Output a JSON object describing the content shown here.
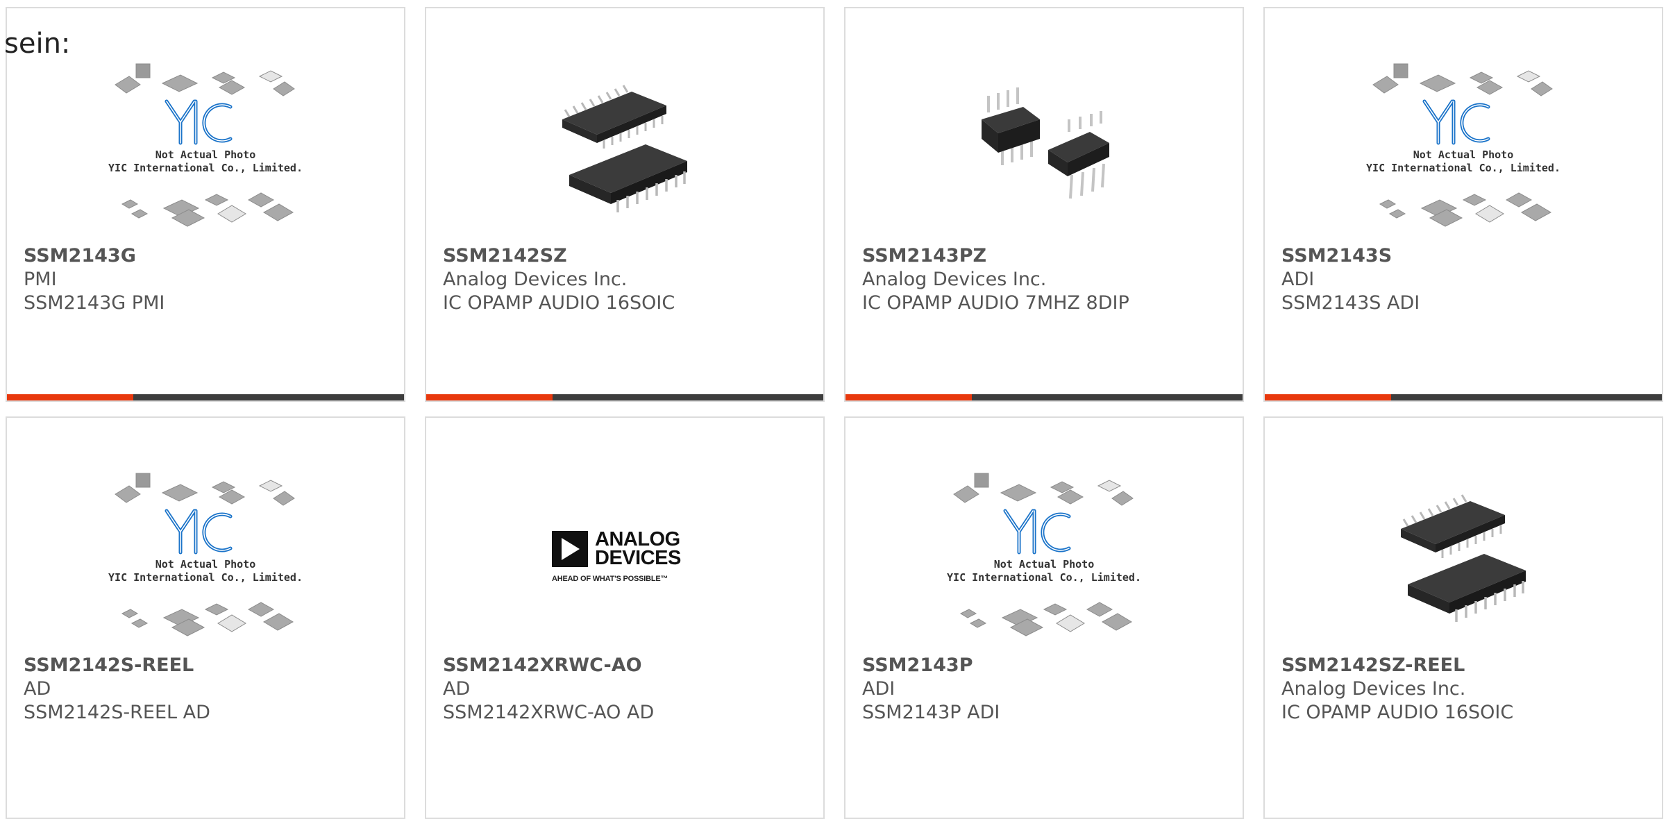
{
  "intro": "sein:",
  "placeholder_photo": {
    "line1": "Not Actual Photo",
    "line2": "YIC International Co., Limited.",
    "logo": "YIC"
  },
  "brand_logo": {
    "line1": "ANALOG",
    "line2": "DEVICES",
    "tagline": "AHEAD OF WHAT'S POSSIBLE™"
  },
  "colors": {
    "accent": "#e8380d",
    "bar": "#3d3d3d",
    "yic_blue": "#1a73c9"
  },
  "products": [
    {
      "part": "SSM2143G",
      "manufacturer": "PMI",
      "description": "SSM2143G PMI",
      "image": "not-actual-photo"
    },
    {
      "part": "SSM2142SZ",
      "manufacturer": "Analog Devices Inc.",
      "description": "IC OPAMP AUDIO 16SOIC",
      "image": "soic16-chip"
    },
    {
      "part": "SSM2143PZ",
      "manufacturer": "Analog Devices Inc.",
      "description": "IC OPAMP AUDIO 7MHZ 8DIP",
      "image": "dip8-chip"
    },
    {
      "part": "SSM2143S",
      "manufacturer": "ADI",
      "description": "SSM2143S ADI",
      "image": "not-actual-photo"
    },
    {
      "part": "SSM2142S-REEL",
      "manufacturer": "AD",
      "description": "SSM2142S-REEL AD",
      "image": "not-actual-photo"
    },
    {
      "part": "SSM2142XRWC-AO",
      "manufacturer": "AD",
      "description": "SSM2142XRWC-AO AD",
      "image": "analog-devices-logo"
    },
    {
      "part": "SSM2143P",
      "manufacturer": "ADI",
      "description": "SSM2143P ADI",
      "image": "not-actual-photo"
    },
    {
      "part": "SSM2142SZ-REEL",
      "manufacturer": "Analog Devices Inc.",
      "description": "IC OPAMP AUDIO 16SOIC",
      "image": "soic16-chip"
    }
  ]
}
